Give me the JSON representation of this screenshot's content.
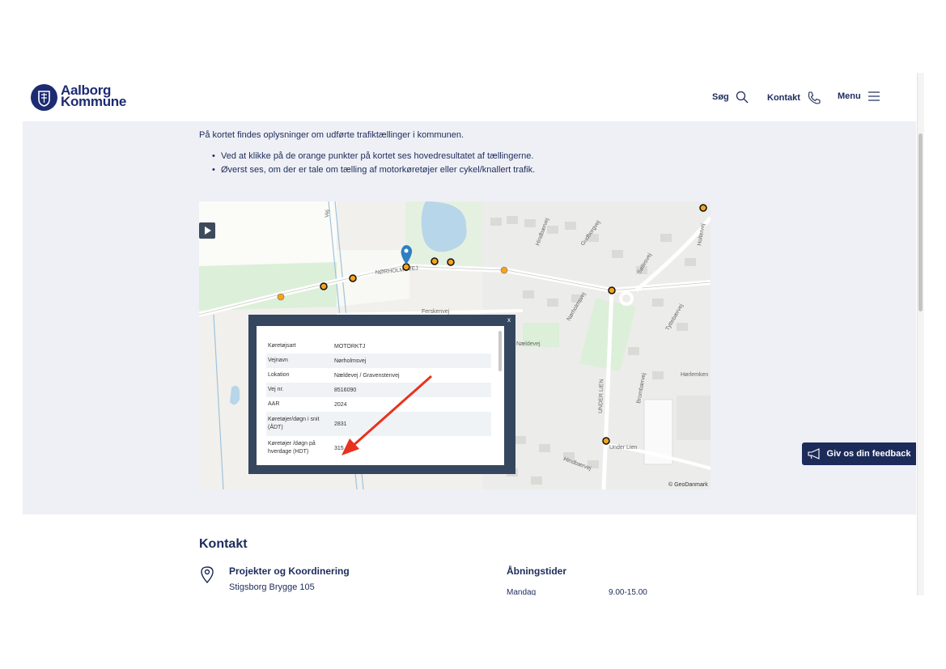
{
  "header": {
    "logo": {
      "line1": "Aalborg",
      "line2": "Kommune"
    },
    "nav": [
      {
        "label": "Søg",
        "icon": "search-icon"
      },
      {
        "label": "Kontakt",
        "icon": "phone-icon"
      },
      {
        "label": "Menu",
        "icon": "hamburger-icon"
      }
    ]
  },
  "intro": {
    "text": "På kortet findes oplysninger om udførte trafiktællinger i kommunen.",
    "bullets": [
      "Ved at klikke på de orange punkter på kortet ses hovedresultatet af tællingerne.",
      "Øverst ses, om der er tale om tælling af motorkøretøjer eller cykel/knallert trafik."
    ]
  },
  "map": {
    "street_labels": [
      "NØRHOLMSVEJ",
      "Ferskenvej",
      "Nældevej",
      "Søllesvej",
      "Nørholmsvej",
      "Tyttebærvej",
      "Hindbærvej",
      "Brombærvej",
      "Hørlemken",
      "Gudborgvej",
      "Holtervej",
      "UNDER LIEN",
      "Under Lien",
      "Hindbærvej",
      "Vej"
    ],
    "attribution": "© GeoDanmark",
    "popup": {
      "close": "x",
      "rows": [
        {
          "key": "Køretøjsart",
          "value": "MOTORKTJ"
        },
        {
          "key": "Vejnavn",
          "value": "Nørholmsvej"
        },
        {
          "key": "Lokation",
          "value": "Nældevej / Gravenstenvej"
        },
        {
          "key": "Vej nr.",
          "value": "8516090"
        },
        {
          "key": "AAR",
          "value": "2024"
        },
        {
          "key": "Køretøjer/døgn i snit (ÅDT)",
          "value": "2831"
        },
        {
          "key": "Køretøjer /døgn på hverdage (HDT)",
          "value": "315"
        }
      ]
    },
    "colors": {
      "marker_orange": "#f5a31f",
      "annotation_arrow": "#e8321d",
      "pin_blue": "#2f7fc1"
    }
  },
  "feedback": {
    "label": "Giv os din feedback",
    "icon": "megaphone-icon"
  },
  "contact": {
    "title": "Kontakt",
    "department": "Projekter og Koordinering",
    "street": "Stigsborg Brygge 105",
    "hours_title": "Åbningstider",
    "hours": [
      {
        "day": "Mandag",
        "time": "9.00-15.00"
      }
    ]
  },
  "theme": {
    "brand": "#1c2b5a",
    "band": "#eff0f6"
  }
}
